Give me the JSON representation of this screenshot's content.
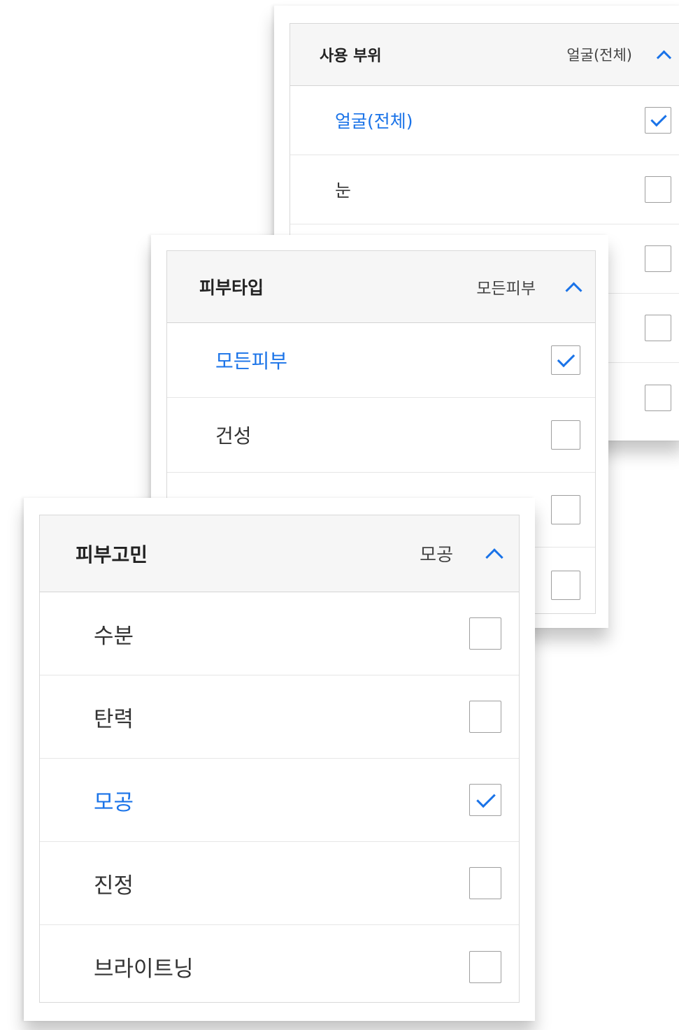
{
  "usage_area": {
    "title": "사용 부위",
    "selected_value": "얼굴(전체)",
    "options": [
      {
        "label": "얼굴(전체)",
        "checked": true
      },
      {
        "label": "눈",
        "checked": false
      },
      {
        "label": "",
        "checked": false
      },
      {
        "label": "",
        "checked": false
      },
      {
        "label": "",
        "checked": false
      }
    ]
  },
  "skin_type": {
    "title": "피부타입",
    "selected_value": "모든피부",
    "options": [
      {
        "label": "모든피부",
        "checked": true
      },
      {
        "label": "건성",
        "checked": false
      },
      {
        "label": "",
        "checked": false
      },
      {
        "label": "",
        "checked": false
      }
    ]
  },
  "skin_concern": {
    "title": "피부고민",
    "selected_value": "모공",
    "options": [
      {
        "label": "수분",
        "checked": false
      },
      {
        "label": "탄력",
        "checked": false
      },
      {
        "label": "모공",
        "checked": true
      },
      {
        "label": "진정",
        "checked": false
      },
      {
        "label": "브라이트닝",
        "checked": false
      }
    ]
  },
  "colors": {
    "accent": "#1a73e8",
    "header_bg": "#f6f6f6",
    "checkbox_border": "#9e9e9e"
  },
  "icons": {
    "collapse": "chevron-up-icon",
    "checked": "checkmark-icon"
  }
}
